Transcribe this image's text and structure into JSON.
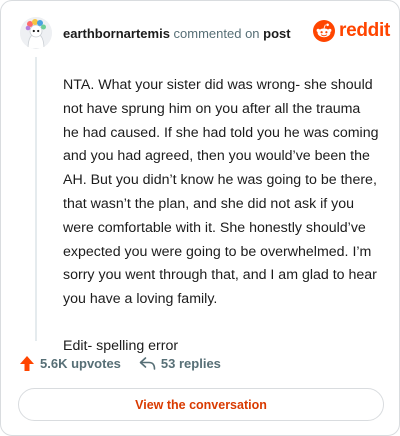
{
  "header": {
    "username": "earthbornartemis",
    "action_text": "commented on",
    "post_link": "post",
    "logo_text": "reddit"
  },
  "comment": {
    "paragraphs": [
      "NTA. What your sister did was wrong- she should not have sprung him on you after all the trauma he had caused. If she had told you he was coming and you had agreed, then you would’ve been the AH. But you didn’t know he was going to be there, that wasn’t the plan, and she did not ask if you were comfortable with it. She honestly should’ve expected you were going to be overwhelmed. I’m sorry you went through that, and I am glad to hear you have a loving family.",
      "Edit- spelling error"
    ]
  },
  "footer": {
    "upvotes": "5.6K upvotes",
    "replies": "53 replies"
  },
  "cta": {
    "label": "View the conversation"
  },
  "colors": {
    "brand": "#ff4500",
    "cta_text": "#d93a00",
    "muted": "#576f76"
  }
}
